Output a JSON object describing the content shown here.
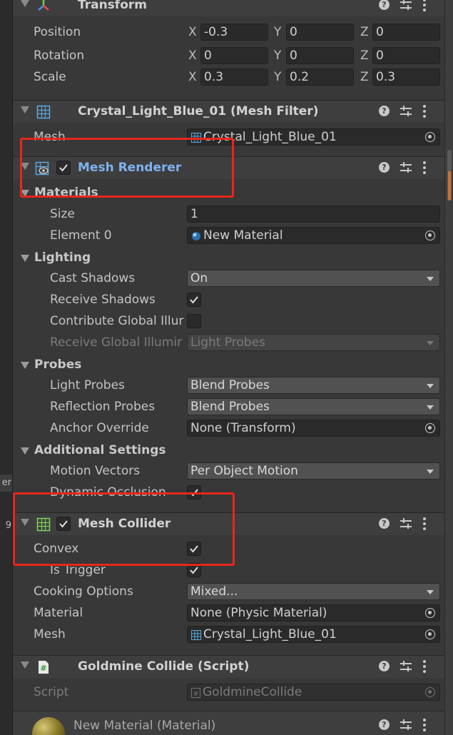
{
  "left_strip": {
    "tab1": "er",
    "tab2": "9"
  },
  "transform": {
    "title": "Transform",
    "position": {
      "label": "Position",
      "x": "-0.3",
      "y": "0",
      "z": "0"
    },
    "rotation": {
      "label": "Rotation",
      "x": "0",
      "y": "0",
      "z": "0"
    },
    "scale": {
      "label": "Scale",
      "x": "0.3",
      "y": "0.2",
      "z": "0.3"
    },
    "axis_x": "X",
    "axis_y": "Y",
    "axis_z": "Z"
  },
  "mesh_filter": {
    "title": "Crystal_Light_Blue_01 (Mesh Filter)",
    "mesh_label": "Mesh",
    "mesh_value": "Crystal_Light_Blue_01"
  },
  "mesh_renderer": {
    "title": "Mesh Renderer",
    "enabled": true,
    "materials_label": "Materials",
    "size_label": "Size",
    "size_value": "1",
    "element0_label": "Element 0",
    "element0_value": "New Material",
    "lighting_label": "Lighting",
    "cast_shadows_label": "Cast Shadows",
    "cast_shadows_value": "On",
    "receive_shadows_label": "Receive Shadows",
    "receive_shadows": true,
    "contribute_gi_label": "Contribute Global Illur",
    "contribute_gi": false,
    "receive_gi_label": "Receive Global Illumir",
    "receive_gi_value": "Light Probes",
    "probes_label": "Probes",
    "light_probes_label": "Light Probes",
    "light_probes_value": "Blend Probes",
    "reflection_probes_label": "Reflection Probes",
    "reflection_probes_value": "Blend Probes",
    "anchor_override_label": "Anchor Override",
    "anchor_override_value": "None (Transform)",
    "additional_settings_label": "Additional Settings",
    "motion_vectors_label": "Motion Vectors",
    "motion_vectors_value": "Per Object Motion",
    "dynamic_occlusion_label": "Dynamic Occlusion",
    "dynamic_occlusion": true
  },
  "mesh_collider": {
    "title": "Mesh Collider",
    "enabled": true,
    "convex_label": "Convex",
    "convex": true,
    "is_trigger_label": "Is Trigger",
    "is_trigger": true,
    "cooking_options_label": "Cooking Options",
    "cooking_options_value": "Mixed...",
    "material_label": "Material",
    "material_value": "None (Physic Material)",
    "mesh_label": "Mesh",
    "mesh_value": "Crystal_Light_Blue_01"
  },
  "script_component": {
    "title": "Goldmine Collide (Script)",
    "script_label": "Script",
    "script_value": "GoldmineCollide"
  },
  "material_component": {
    "title": "New Material (Material)"
  },
  "colors": {
    "highlight_box": "#e8261c",
    "active_title": "#7fb2f0",
    "panel_bg": "#383838",
    "header_bg": "#3e3e3e"
  }
}
